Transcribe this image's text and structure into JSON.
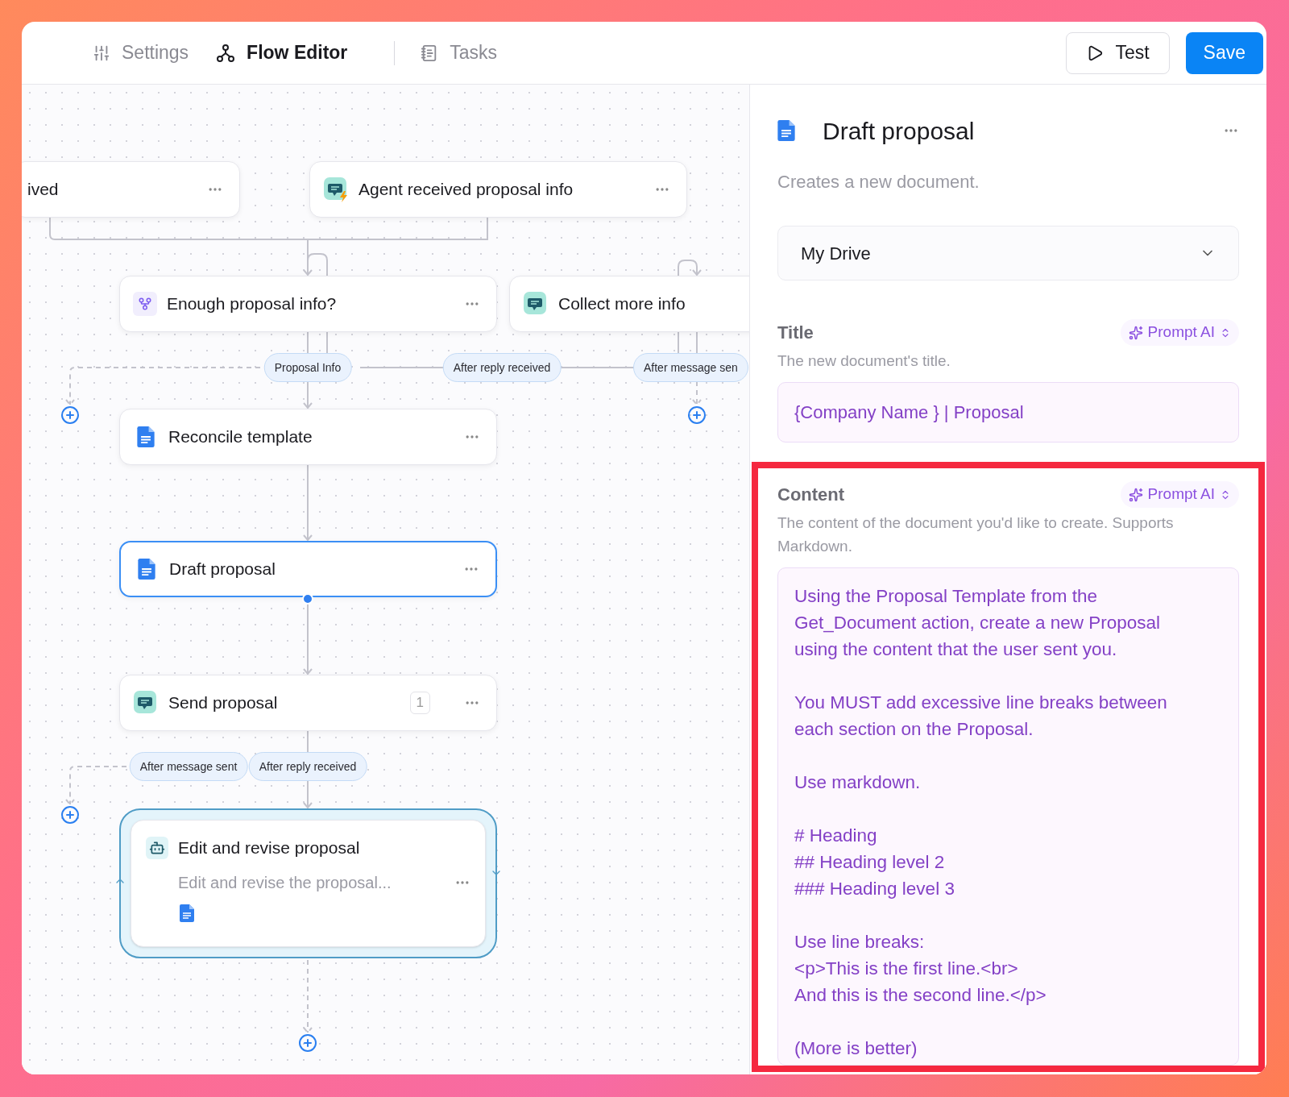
{
  "toolbar": {
    "tabs": [
      {
        "label": "Settings",
        "kind": "settings",
        "selected": false
      },
      {
        "label": "Flow Editor",
        "kind": "flow",
        "selected": true
      },
      {
        "label": "Tasks",
        "kind": "tasks",
        "selected": false
      }
    ],
    "actions": [
      {
        "label": "Test",
        "kind": "test"
      },
      {
        "label": "Save",
        "kind": "save"
      }
    ]
  },
  "canvas": {
    "nodes": [
      {
        "label": "ived",
        "kind": "trigger",
        "selected": false
      },
      {
        "label": "Agent received proposal info",
        "kind": "trigger",
        "selected": false
      },
      {
        "label": "Enough proposal info?",
        "kind": "branch",
        "selected": false
      },
      {
        "label": "Collect more info",
        "kind": "message",
        "selected": false
      },
      {
        "label": "Reconcile template",
        "kind": "document",
        "selected": false
      },
      {
        "label": "Draft proposal",
        "kind": "document",
        "selected": true
      },
      {
        "label": "Send proposal",
        "kind": "message",
        "selected": false,
        "badge": "1"
      },
      {
        "label": "Edit and revise proposal",
        "kind": "agent",
        "selected": false,
        "subtitle": "Edit and revise the proposal..."
      }
    ],
    "edges": [
      {
        "label": "Proposal Info"
      },
      {
        "label": "After reply received"
      },
      {
        "label": "After message sen"
      },
      {
        "label": "After message sent"
      },
      {
        "label": "After reply received"
      }
    ]
  },
  "panel": {
    "title": "Draft proposal",
    "description": "Creates a new document.",
    "drive": "My Drive",
    "fields": [
      {
        "label": "Title",
        "hint": "The new document's title.",
        "prompt": "Prompt AI",
        "value": "{Company Name } | Proposal",
        "highlighted": false
      },
      {
        "label": "Content",
        "hint": "The content of the document you'd like to create. Supports Markdown.",
        "prompt": "Prompt AI",
        "value": "Using the Proposal Template from the Get_Document action, create a new Proposal using the content that the user sent you.\n\nYou MUST add excessive line breaks between each section on the Proposal.\n\nUse markdown.\n\n# Heading\n## Heading level 2\n### Heading level 3\n\nUse line breaks:\n<p>This is the first line.<br>\nAnd this is the second line.</p>\n\n(More is better)",
        "highlighted": true
      }
    ]
  }
}
